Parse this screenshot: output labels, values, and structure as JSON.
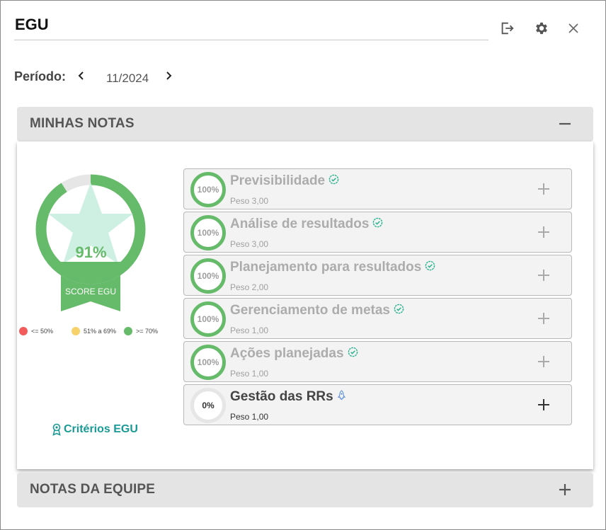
{
  "header": {
    "title": "EGU"
  },
  "period": {
    "label": "Período:",
    "value": "11/2024"
  },
  "sections": {
    "mine": {
      "label": "MINHAS NOTAS"
    },
    "team": {
      "label": "NOTAS DA EQUIPE"
    }
  },
  "score": {
    "value": "91%",
    "fraction": 0.91,
    "ribbon": "SCORE EGU",
    "legend": [
      {
        "label": "<= 50%",
        "color": "#f35a5a"
      },
      {
        "label": "51% a 69%",
        "color": "#f7d26b"
      },
      {
        "label": ">= 70%",
        "color": "#66bb6a"
      }
    ]
  },
  "criteria_link": "Critérios EGU",
  "items": [
    {
      "percent": "100%",
      "name": "Previsibilidade",
      "weight": "Peso 3,00",
      "status_icon": "check-badge-icon"
    },
    {
      "percent": "100%",
      "name": "Análise de resultados",
      "weight": "Peso 3,00",
      "status_icon": "check-badge-icon"
    },
    {
      "percent": "100%",
      "name": "Planejamento para resultados",
      "weight": "Peso 2,00",
      "status_icon": "check-badge-icon"
    },
    {
      "percent": "100%",
      "name": "Gerenciamento de metas",
      "weight": "Peso 1,00",
      "status_icon": "check-badge-icon"
    },
    {
      "percent": "100%",
      "name": "Ações planejadas",
      "weight": "Peso 1,00",
      "status_icon": "check-badge-icon"
    },
    {
      "percent": "0%",
      "name": "Gestão das RRs",
      "weight": "Peso 1,00",
      "status_icon": "rocket-icon"
    }
  ],
  "colors": {
    "accent_green": "#66bb6a",
    "link_teal": "#1a9a96",
    "header_gray": "#e4e4e4"
  }
}
